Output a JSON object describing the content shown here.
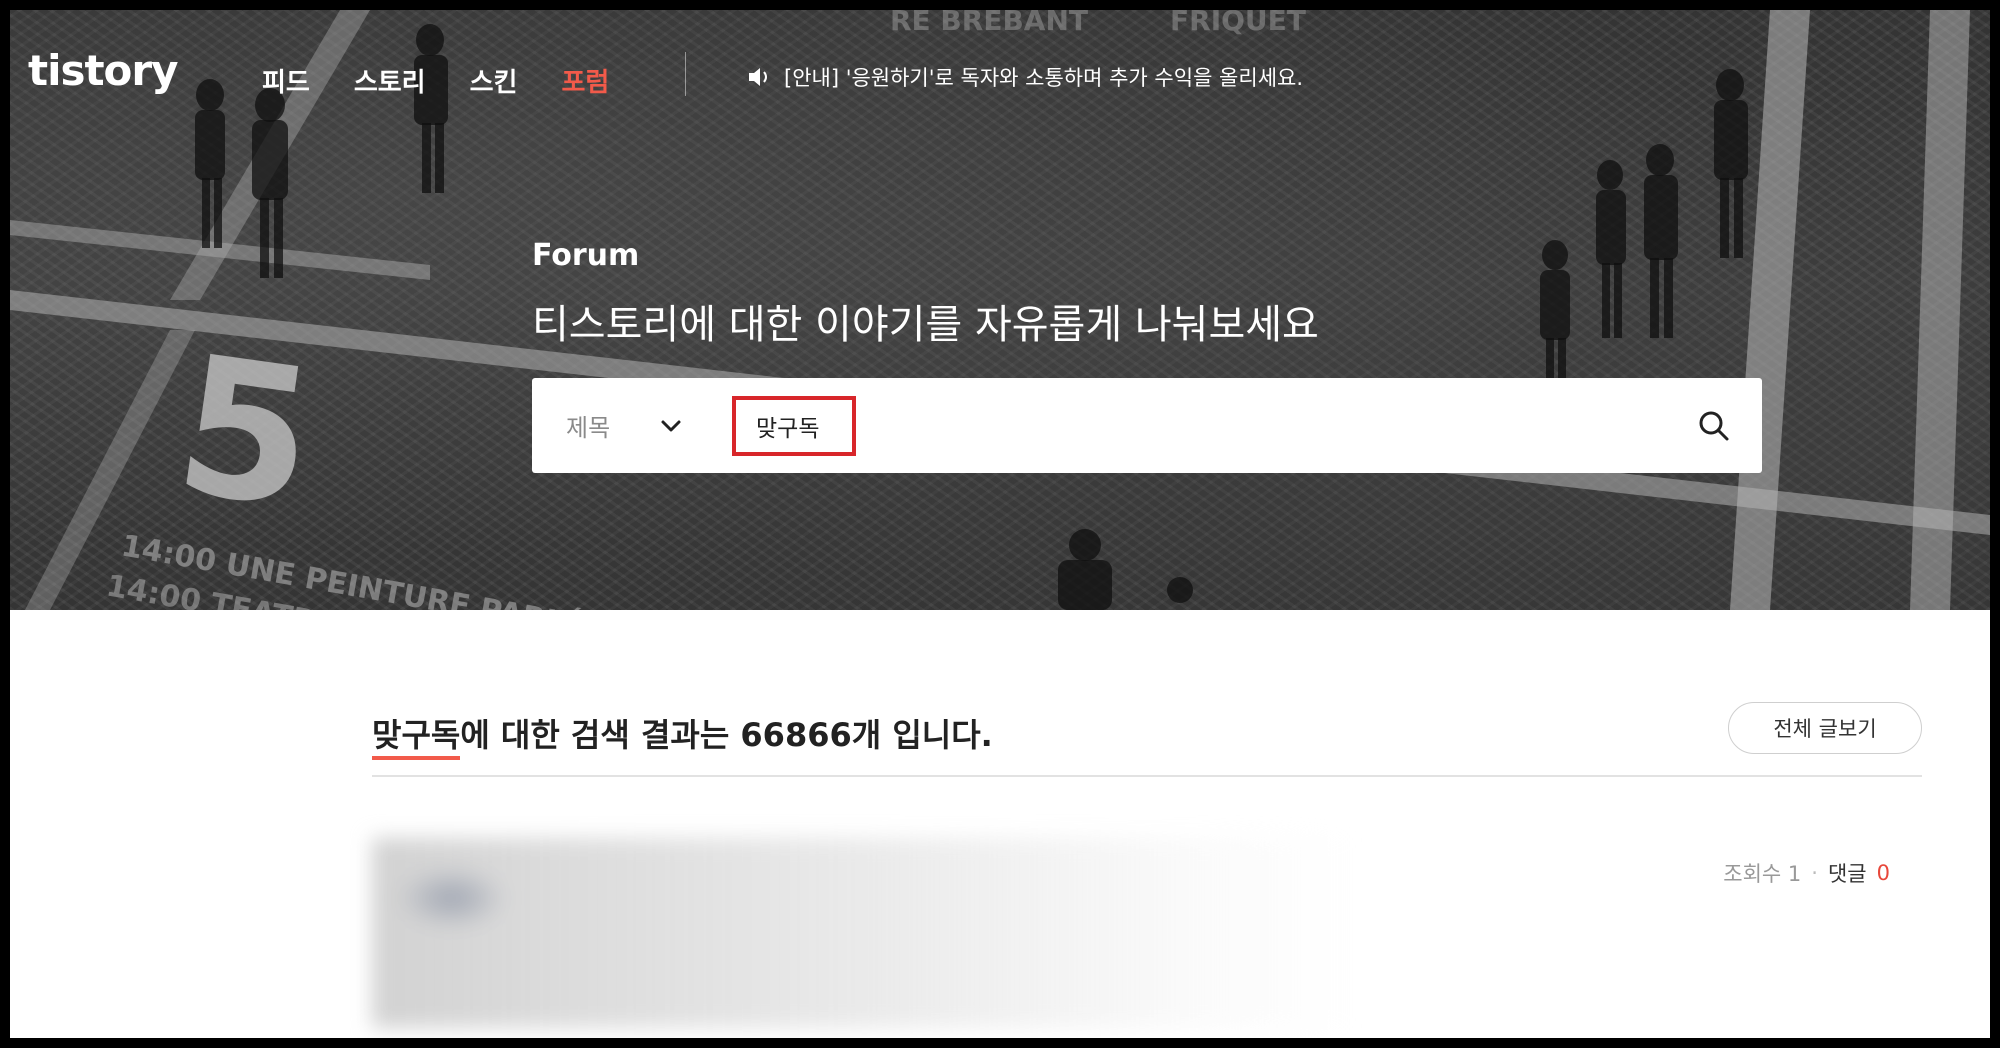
{
  "header": {
    "logo": "tistory",
    "nav": [
      "피드",
      "스토리",
      "스킨",
      "포럼"
    ],
    "active_nav": "포럼",
    "notice": "[안내] '응원하기'로 독자와 소통하며 추가 수익을 올리세요."
  },
  "hero": {
    "title": "Forum",
    "subtitle": "티스토리에 대한 이야기를 자유롭게 나눠보세요"
  },
  "search": {
    "field_select": "제목",
    "query": "맞구독"
  },
  "results": {
    "keyword": "맞구독",
    "summary_suffix": "에 대한 검색 결과는 66866개 입니다.",
    "view_all": "전체 글보기"
  },
  "post": {
    "views_label": "조회수 1",
    "comments_label": "댓글",
    "comments_count": "0"
  },
  "colors": {
    "accent": "#f25a4a",
    "highlight_box": "#d8262a"
  }
}
